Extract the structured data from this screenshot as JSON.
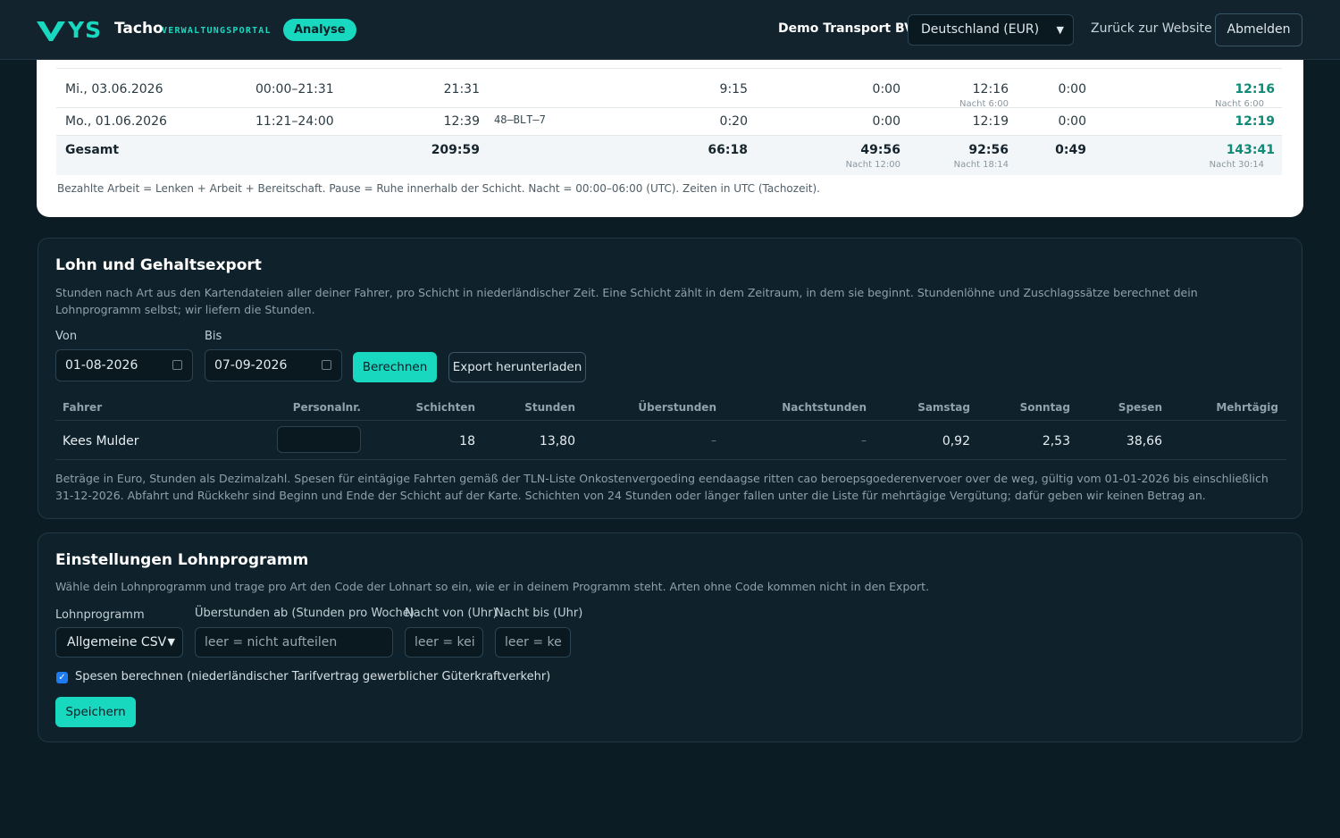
{
  "header": {
    "logo_text": "YS",
    "brand": "Tacho",
    "brand_sub": "VERWALTUNGSPORTAL",
    "badge": "Analyse",
    "company": "Demo Transport BV",
    "country_select": "Deutschland (EUR)",
    "back_link": "Zurück zur Website",
    "logout": "Abmelden"
  },
  "shift_table": {
    "rows": [
      {
        "date": "Mi., 03.06.2026",
        "time": "00:00–21:31",
        "duration": "21:31",
        "plate": "",
        "pause": "9:15",
        "c1": "0:00",
        "c2": "12:16",
        "c2_sub": "Nacht 6:00",
        "c3": "0:00",
        "paid": "12:16",
        "paid_sub": "Nacht 6:00"
      },
      {
        "date": "Mo., 01.06.2026",
        "time": "11:21–24:00",
        "duration": "12:39",
        "plate": "48–BLT–7",
        "pause": "0:20",
        "c1": "0:00",
        "c2": "12:19",
        "c2_sub": "",
        "c3": "0:00",
        "paid": "12:19",
        "paid_sub": ""
      }
    ],
    "total": {
      "label": "Gesamt",
      "duration": "209:59",
      "pause": "66:18",
      "c1": "49:56",
      "c1_sub": "Nacht 12:00",
      "c2": "92:56",
      "c2_sub": "Nacht 18:14",
      "c3": "0:49",
      "paid": "143:41",
      "paid_sub": "Nacht 30:14"
    },
    "note": "Bezahlte Arbeit = Lenken + Arbeit + Bereitschaft. Pause = Ruhe innerhalb der Schicht. Nacht = 00:00–06:00 (UTC). Zeiten in UTC (Tachozeit)."
  },
  "export": {
    "title": "Lohn und Gehaltsexport",
    "description": "Stunden nach Art aus den Kartendateien aller deiner Fahrer, pro Schicht in niederländischer Zeit. Eine Schicht zählt in dem Zeitraum, in dem sie beginnt. Stundenlöhne und Zuschlagssätze berechnet dein Lohnprogramm selbst; wir liefern die Stunden.",
    "from_label": "Von",
    "from_value": "01-08-2026",
    "to_label": "Bis",
    "to_value": "07-09-2026",
    "calc_button": "Berechnen",
    "download_button": "Export herunterladen",
    "columns": [
      "Fahrer",
      "Personalnr.",
      "Schichten",
      "Stunden",
      "Überstunden",
      "Nachtstunden",
      "Samstag",
      "Sonntag",
      "Spesen",
      "Mehrtägig"
    ],
    "rows": [
      {
        "driver": "Kees Mulder",
        "personnel_no": "",
        "shifts": "18",
        "hours": "13,80",
        "overtime": "–",
        "night": "–",
        "saturday": "0,92",
        "sunday": "2,53",
        "expenses": "38,66",
        "multiday": ""
      }
    ],
    "footnote": "Beträge in Euro, Stunden als Dezimalzahl. Spesen für eintägige Fahrten gemäß der TLN-Liste Onkostenvergoeding eendaagse ritten cao beroepsgoederenvervoer over de weg, gültig vom 01-01-2026 bis einschließlich 31-12-2026. Abfahrt und Rückkehr sind Beginn und Ende der Schicht auf der Karte. Schichten von 24 Stunden oder länger fallen unter die Liste für mehrtägige Vergütung; dafür geben wir keinen Betrag an."
  },
  "settings": {
    "title": "Einstellungen Lohnprogramm",
    "description": "Wähle dein Lohnprogramm und trage pro Art den Code der Lohnart so ein, wie er in deinem Programm steht. Arten ohne Code kommen nicht in den Export.",
    "program_label": "Lohnprogramm",
    "program_value": "Allgemeine CSV",
    "overtime_label": "Überstunden ab (Stunden pro Woche)",
    "overtime_placeholder": "leer = nicht aufteilen",
    "night_from_label": "Nacht von (Uhr)",
    "night_from_placeholder": "leer = kei",
    "night_to_label": "Nacht bis (Uhr)",
    "night_to_placeholder": "leer = ke",
    "checkbox_label": "Spesen berechnen (niederländischer Tarifvertrag gewerblicher Güterkraftverkehr)",
    "checkbox_checked": true,
    "save_button": "Speichern"
  },
  "colors": {
    "accent": "#18d8c0",
    "background": "#0c1c25",
    "card": "#0f212b",
    "green_value": "#0f8a76"
  }
}
